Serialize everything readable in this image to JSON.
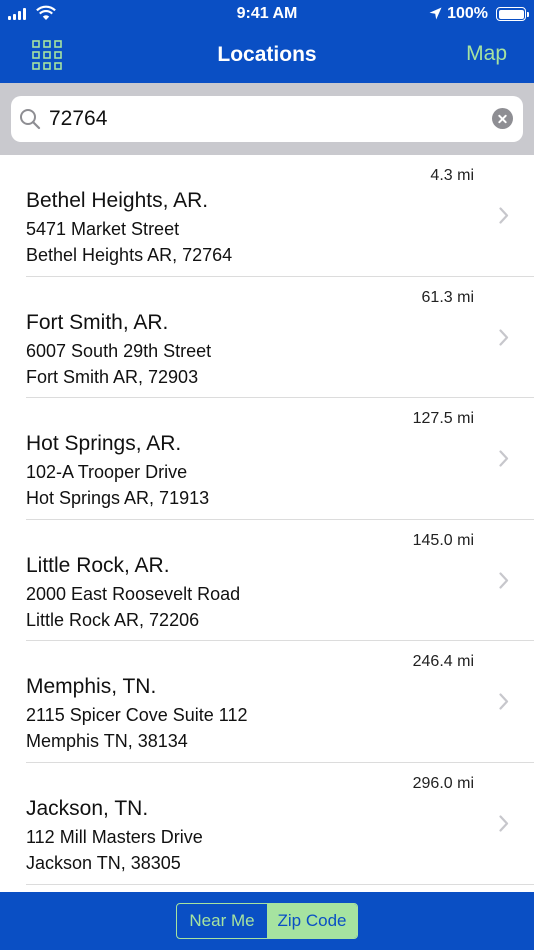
{
  "status_bar": {
    "time": "9:41 AM",
    "battery": "100%"
  },
  "nav": {
    "title": "Locations",
    "right_button": "Map",
    "left_icon": "grid-icon"
  },
  "search": {
    "value": "72764",
    "placeholder": ""
  },
  "locations": [
    {
      "distance": "4.3 mi",
      "name": "Bethel Heights, AR.",
      "street": "5471 Market Street",
      "city": "Bethel Heights AR, 72764"
    },
    {
      "distance": "61.3 mi",
      "name": "Fort Smith, AR.",
      "street": "6007 South 29th Street",
      "city": "Fort Smith AR, 72903"
    },
    {
      "distance": "127.5 mi",
      "name": "Hot Springs, AR.",
      "street": "102-A Trooper Drive",
      "city": "Hot Springs AR, 71913"
    },
    {
      "distance": "145.0 mi",
      "name": "Little Rock, AR.",
      "street": "2000 East Roosevelt Road",
      "city": "Little Rock AR, 72206"
    },
    {
      "distance": "246.4 mi",
      "name": "Memphis, TN.",
      "street": "2115 Spicer Cove Suite 112",
      "city": "Memphis TN, 38134"
    },
    {
      "distance": "296.0 mi",
      "name": "Jackson, TN.",
      "street": "112 Mill Masters Drive",
      "city": "Jackson TN, 38305"
    }
  ],
  "segments": {
    "near_me": "Near Me",
    "zip_code": "Zip Code",
    "selected": "Zip Code"
  },
  "colors": {
    "brand_blue": "#0a4fc4",
    "accent_green": "#a6e3a0"
  }
}
